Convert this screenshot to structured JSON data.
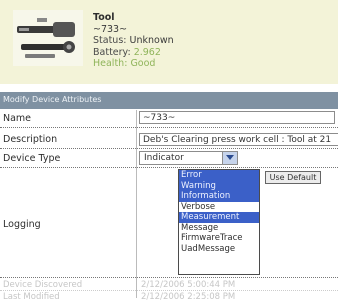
{
  "header": {
    "title": "Tool",
    "id_text": "~733~",
    "status_label": "Status:",
    "status_value": "Unknown",
    "battery_label": "Battery:",
    "battery_value": "2.962",
    "health_label": "Health:",
    "health_value": "Good"
  },
  "section": {
    "title": "Modify Device Attributes"
  },
  "fields": {
    "name_label": "Name",
    "name_value": "~733~",
    "description_label": "Description",
    "description_value": "Deb's Clearing press work cell : Tool at 21",
    "device_type_label": "Device Type",
    "device_type_value": "Indicator",
    "logging_label": "Logging",
    "use_default_label": "Use Default",
    "discovered_label": "Device Discovered",
    "discovered_value": "2/12/2006 5:00:44 PM",
    "modified_label": "Last Modified",
    "modified_value": "2/12/2006 2:25:08 PM"
  },
  "logging_options": [
    {
      "label": "Error",
      "selected": true
    },
    {
      "label": "Warning",
      "selected": true
    },
    {
      "label": "Information",
      "selected": true
    },
    {
      "label": "Verbose",
      "selected": false
    },
    {
      "label": "Measurement",
      "selected": true
    },
    {
      "label": "Message",
      "selected": false
    },
    {
      "label": "FirmwareTrace",
      "selected": false
    },
    {
      "label": "UadMessage",
      "selected": false
    }
  ],
  "colors": {
    "header_bg": "#f3f3d8",
    "section_bar": "#7f91a2",
    "selection": "#3b60c8",
    "good_green": "#8fb45a"
  },
  "icons": {
    "tool_image": "torque-tool-icon",
    "dropdown": "chevron-down-icon"
  }
}
